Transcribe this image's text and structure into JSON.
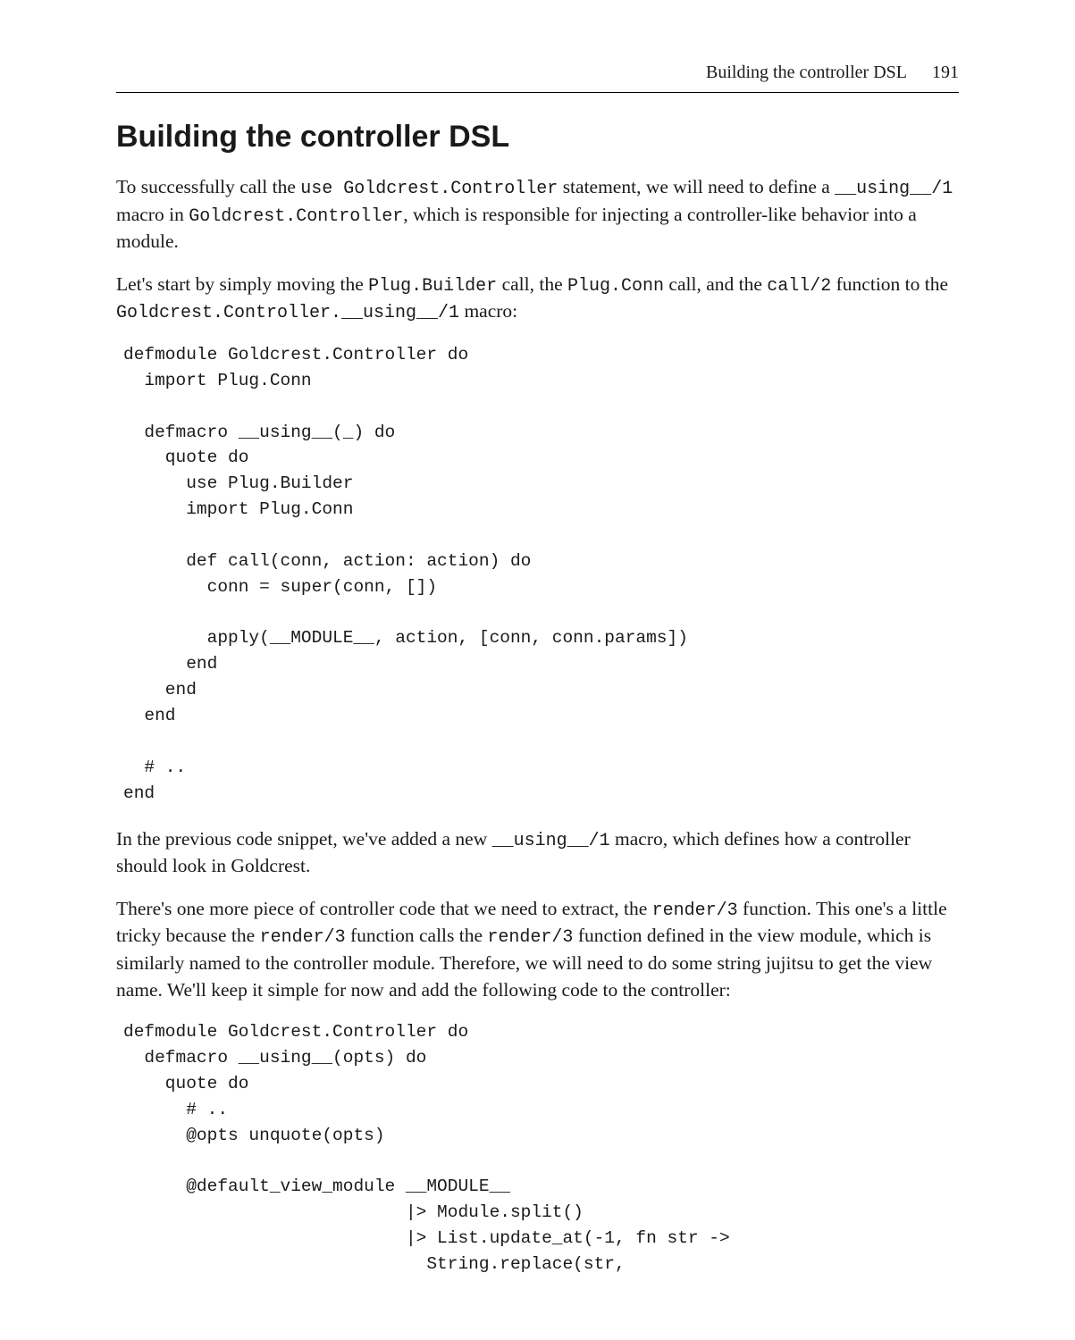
{
  "header": {
    "running_title": "Building the controller DSL",
    "page_number": "191"
  },
  "section": {
    "title": "Building the controller DSL"
  },
  "paragraphs": {
    "p1_a": "To successfully call the ",
    "p1_code1": "use Goldcrest.Controller",
    "p1_b": " statement, we will need to define a ",
    "p1_code2": "__using__/1",
    "p1_c": " macro in ",
    "p1_code3": "Goldcrest.Controller",
    "p1_d": ", which is responsible for injecting a controller-like behavior into a module.",
    "p2_a": "Let's start by simply moving the ",
    "p2_code1": "Plug.Builder",
    "p2_b": " call, the ",
    "p2_code2": "Plug.Conn",
    "p2_c": " call, and the ",
    "p2_code3": "call/2",
    "p2_d": " function to the ",
    "p2_code4": "Goldcrest.Controller.__using__/1",
    "p2_e": " macro:",
    "p3_a": "In the previous code snippet, we've added a new ",
    "p3_code1": "__using__/1",
    "p3_b": " macro, which defines how a controller should look in Goldcrest.",
    "p4_a": "There's one more piece of controller code that we need to extract, the ",
    "p4_code1": "render/3",
    "p4_b": " function. This one's a little tricky because the ",
    "p4_code2": "render/3",
    "p4_c": " function calls the ",
    "p4_code3": "render/3",
    "p4_d": " function defined in the view module, which is similarly named to the controller module. Therefore, we will need to do some string jujitsu to get the view name. We'll keep it simple for now and add the following code to the controller:"
  },
  "code_blocks": {
    "block1": "defmodule Goldcrest.Controller do\n  import Plug.Conn\n\n  defmacro __using__(_) do\n    quote do\n      use Plug.Builder\n      import Plug.Conn\n\n      def call(conn, action: action) do\n        conn = super(conn, [])\n\n        apply(__MODULE__, action, [conn, conn.params])\n      end\n    end\n  end\n\n  # ..\nend",
    "block2": "defmodule Goldcrest.Controller do\n  defmacro __using__(opts) do\n    quote do\n      # ..\n      @opts unquote(opts)\n\n      @default_view_module __MODULE__\n                           |> Module.split()\n                           |> List.update_at(-1, fn str ->\n                             String.replace(str,"
  }
}
